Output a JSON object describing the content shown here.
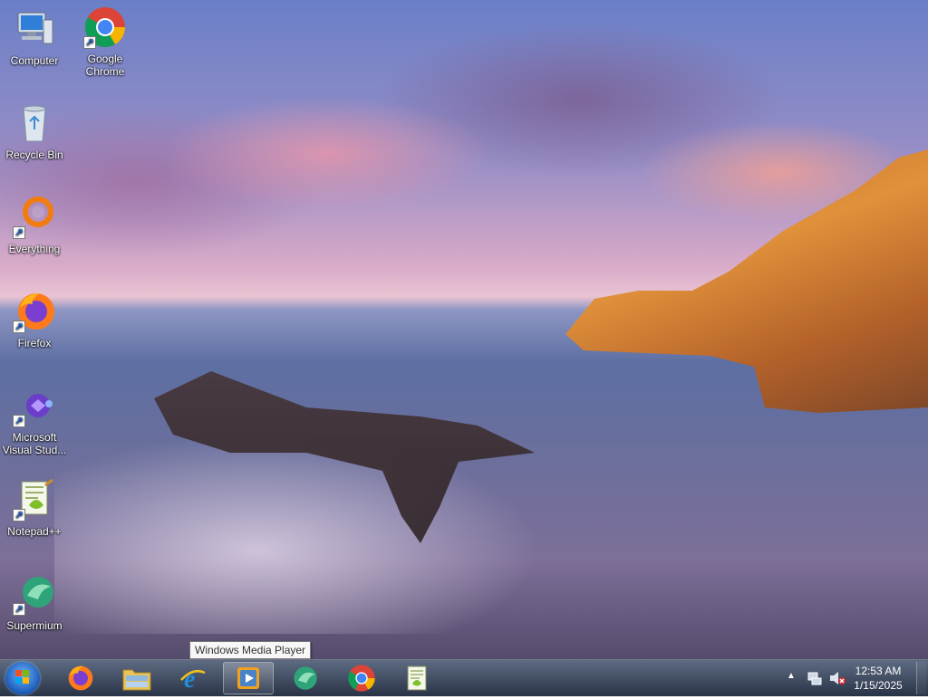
{
  "desktop": {
    "icons": [
      {
        "label": "Computer",
        "icon": "computer-icon"
      },
      {
        "label": "Google Chrome",
        "icon": "chrome-icon"
      },
      {
        "label": "Recycle Bin",
        "icon": "recycle-bin-icon"
      },
      {
        "label": "Everything",
        "icon": "everything-icon"
      },
      {
        "label": "Firefox",
        "icon": "firefox-icon"
      },
      {
        "label": "Microsoft Visual Stud...",
        "icon": "visual-studio-icon"
      },
      {
        "label": "Notepad++",
        "icon": "notepad-plus-plus-icon"
      },
      {
        "label": "Supermium",
        "icon": "supermium-icon"
      }
    ]
  },
  "tooltip": {
    "text": "Windows Media Player"
  },
  "taskbar": {
    "start": {
      "icon": "windows-start-icon"
    },
    "pinned": [
      {
        "name": "Firefox",
        "icon": "firefox-icon"
      },
      {
        "name": "File Explorer",
        "icon": "folder-icon"
      },
      {
        "name": "Internet Explorer",
        "icon": "internet-explorer-icon"
      },
      {
        "name": "Windows Media Player",
        "icon": "media-player-icon",
        "hovered": true
      },
      {
        "name": "Supermium",
        "icon": "supermium-icon"
      },
      {
        "name": "Google Chrome",
        "icon": "chrome-icon"
      },
      {
        "name": "Notepad++",
        "icon": "notepad-plus-plus-icon"
      }
    ],
    "tray": {
      "time": "12:53 AM",
      "date": "1/15/2025",
      "icons": [
        "show-hidden-icons-chevron",
        "network-icon",
        "volume-muted-icon"
      ]
    }
  },
  "colors": {
    "taskbar": "#2a3550",
    "accent": "#1a5bb8"
  }
}
